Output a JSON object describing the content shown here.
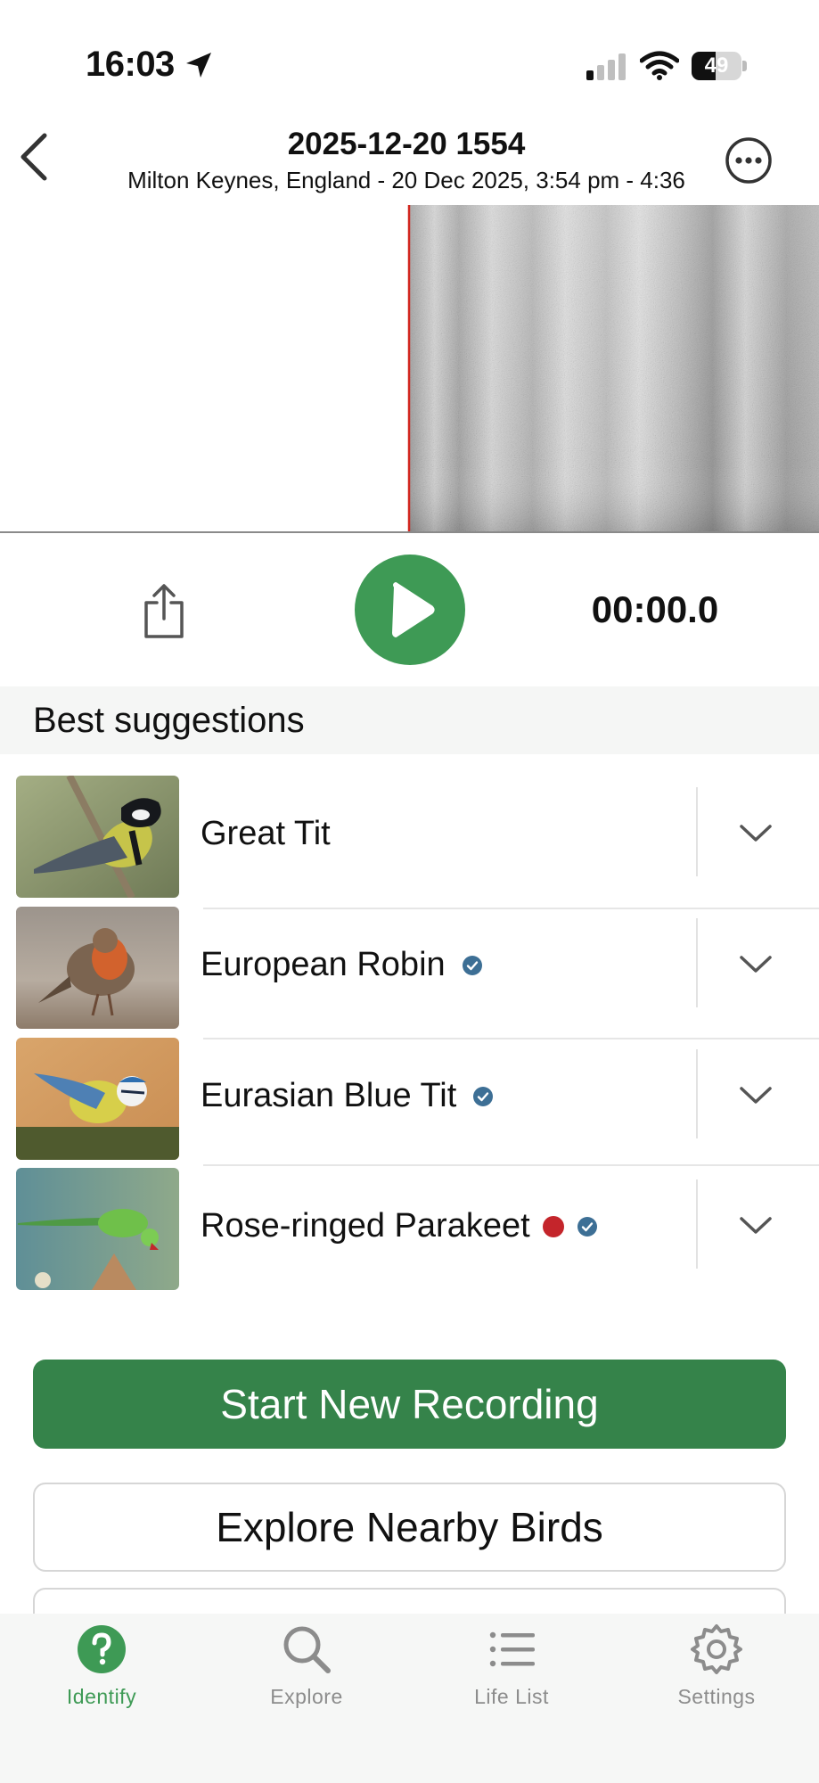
{
  "status_bar": {
    "time": "16:03",
    "battery": "49",
    "battery_level": 0.49
  },
  "header": {
    "title": "2025-12-20 1554",
    "subtitle": "Milton Keynes, England - 20 Dec 2025, 3:54 pm - 4:36"
  },
  "player": {
    "timecode": "00:00.0"
  },
  "suggestions": {
    "heading": "Best suggestions",
    "items": [
      {
        "name": "Great Tit",
        "verified": false,
        "invasive": false
      },
      {
        "name": "European Robin",
        "verified": true,
        "invasive": false
      },
      {
        "name": "Eurasian Blue Tit",
        "verified": true,
        "invasive": false
      },
      {
        "name": "Rose-ringed Parakeet",
        "verified": true,
        "invasive": true
      }
    ]
  },
  "buttons": {
    "start_recording": "Start New Recording",
    "explore_nearby": "Explore Nearby Birds"
  },
  "tabs": [
    {
      "label": "Identify",
      "icon": "question-circle-icon",
      "active": true
    },
    {
      "label": "Explore",
      "icon": "search-icon",
      "active": false
    },
    {
      "label": "Life List",
      "icon": "list-icon",
      "active": false
    },
    {
      "label": "Settings",
      "icon": "gear-icon",
      "active": false
    }
  ],
  "colors": {
    "accent_green": "#3e9a55",
    "button_green": "#35834a",
    "verified_blue": "#3d6f95",
    "invasive_red": "#c4252b",
    "playhead_red": "#d2261f"
  }
}
